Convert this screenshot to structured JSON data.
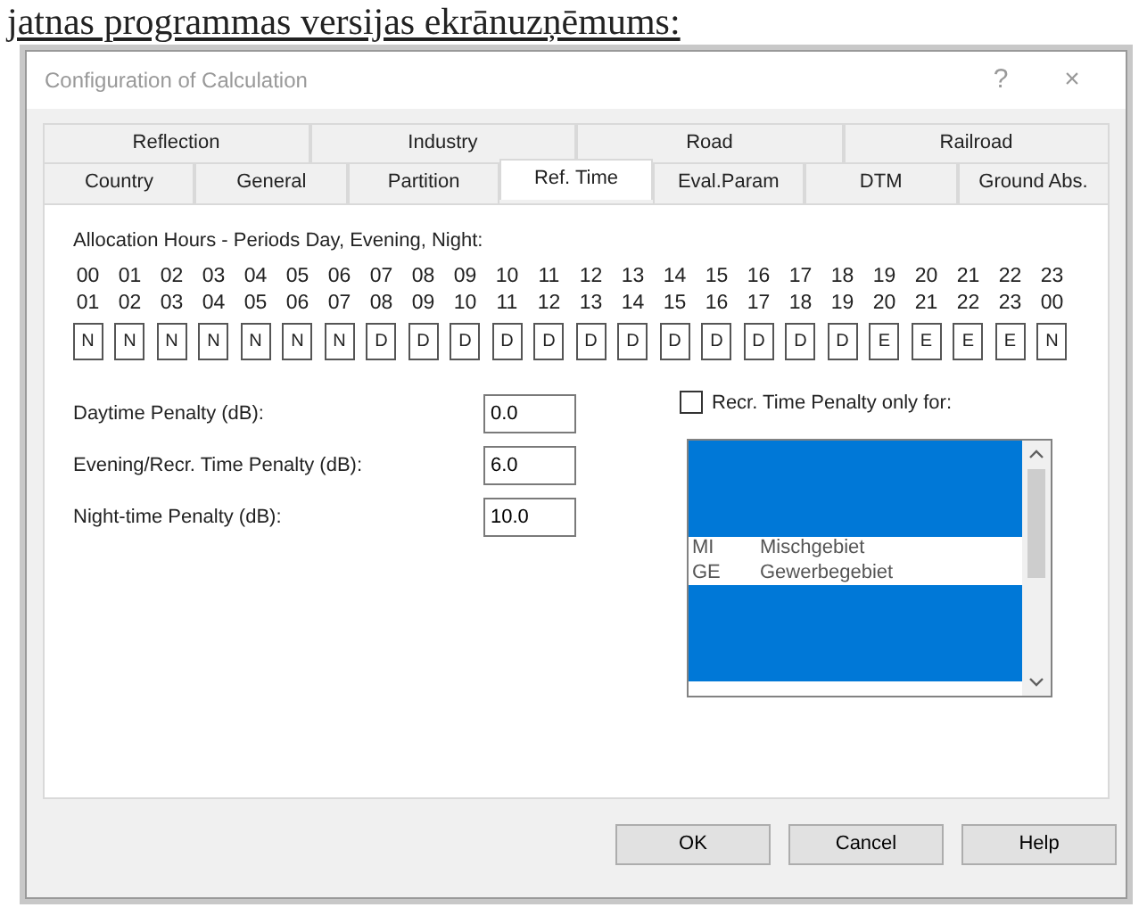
{
  "caption": "jatnas programmas versijas ekrānuzņēmums:",
  "window": {
    "title": "Configuration of Calculation",
    "help": "?",
    "close": "×"
  },
  "tab_rows": [
    [
      {
        "label": "Reflection",
        "selected": false
      },
      {
        "label": "Industry",
        "selected": false
      },
      {
        "label": "Road",
        "selected": false
      },
      {
        "label": "Railroad",
        "selected": false
      }
    ],
    [
      {
        "label": "Country",
        "selected": false
      },
      {
        "label": "General",
        "selected": false
      },
      {
        "label": "Partition",
        "selected": false
      },
      {
        "label": "Ref. Time",
        "selected": true
      },
      {
        "label": "Eval.Param",
        "selected": false
      },
      {
        "label": "DTM",
        "selected": false
      },
      {
        "label": "Ground Abs.",
        "selected": false
      }
    ]
  ],
  "allocation": {
    "label": "Allocation Hours - Periods Day, Evening, Night:",
    "hours": [
      {
        "from": "00",
        "to": "01",
        "period": "N"
      },
      {
        "from": "01",
        "to": "02",
        "period": "N"
      },
      {
        "from": "02",
        "to": "03",
        "period": "N"
      },
      {
        "from": "03",
        "to": "04",
        "period": "N"
      },
      {
        "from": "04",
        "to": "05",
        "period": "N"
      },
      {
        "from": "05",
        "to": "06",
        "period": "N"
      },
      {
        "from": "06",
        "to": "07",
        "period": "N"
      },
      {
        "from": "07",
        "to": "08",
        "period": "D"
      },
      {
        "from": "08",
        "to": "09",
        "period": "D"
      },
      {
        "from": "09",
        "to": "10",
        "period": "D"
      },
      {
        "from": "10",
        "to": "11",
        "period": "D"
      },
      {
        "from": "11",
        "to": "12",
        "period": "D"
      },
      {
        "from": "12",
        "to": "13",
        "period": "D"
      },
      {
        "from": "13",
        "to": "14",
        "period": "D"
      },
      {
        "from": "14",
        "to": "15",
        "period": "D"
      },
      {
        "from": "15",
        "to": "16",
        "period": "D"
      },
      {
        "from": "16",
        "to": "17",
        "period": "D"
      },
      {
        "from": "17",
        "to": "18",
        "period": "D"
      },
      {
        "from": "18",
        "to": "19",
        "period": "D"
      },
      {
        "from": "19",
        "to": "20",
        "period": "E"
      },
      {
        "from": "20",
        "to": "21",
        "period": "E"
      },
      {
        "from": "21",
        "to": "22",
        "period": "E"
      },
      {
        "from": "22",
        "to": "23",
        "period": "E"
      },
      {
        "from": "23",
        "to": "00",
        "period": "N"
      }
    ]
  },
  "penalties": [
    {
      "label": "Daytime Penalty (dB):",
      "value": "0.0"
    },
    {
      "label": "Evening/Recr. Time Penalty (dB):",
      "value": "6.0"
    },
    {
      "label": "Night-time Penalty (dB):",
      "value": "10.0"
    }
  ],
  "recr_only": {
    "label": "Recr. Time Penalty only for:",
    "checked": false
  },
  "area_list": [
    {
      "selected": true
    },
    {
      "selected": true
    },
    {
      "selected": true
    },
    {
      "selected": true
    },
    {
      "code": "MI",
      "name": "Mischgebiet",
      "selected": false
    },
    {
      "code": "GE",
      "name": "Gewerbegebiet",
      "selected": false
    },
    {
      "selected": true
    },
    {
      "selected": true
    },
    {
      "selected": true
    },
    {
      "selected": true
    }
  ],
  "buttons": [
    "OK",
    "Cancel",
    "Help"
  ]
}
